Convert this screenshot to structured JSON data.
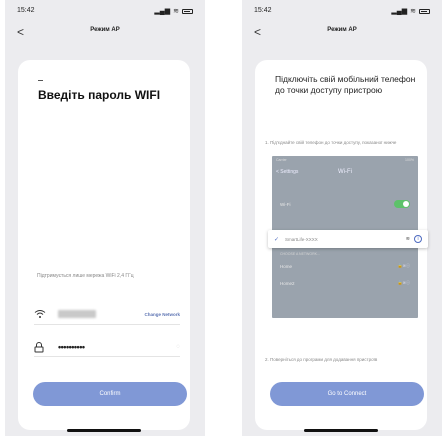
{
  "screens": [
    {
      "status": {
        "time": "15:42"
      },
      "nav": {
        "back": "<",
        "title": "Режим AP"
      },
      "card": {
        "title": "Введіть пароль WIFI",
        "note": "Підтримується лише мережа WiFi 2,4 ГГц",
        "change_network": "Change Network",
        "password": "••••••••••",
        "confirm": "Confirm"
      }
    },
    {
      "status": {
        "time": "15:42"
      },
      "nav": {
        "back": "<",
        "title": "Режим AP"
      },
      "card": {
        "title": "Підключіть свій мобільний телефон до точки доступу пристрою",
        "step1": "1. Під'єднайте свій телефон до точки доступу, показаної нижче",
        "preview": {
          "carrier": "Carrier",
          "battery": "100%",
          "back": "< Settings",
          "title": "Wi-Fi",
          "wifi_row": "Wi-Fi",
          "selected": "SmartLife-XXXX",
          "choose": "CHOOSE A NETWORK...",
          "net1": "Home",
          "net2": "Home2"
        },
        "step2": "2. Поверніться до програми для додавання пристроїв",
        "go_to_connect": "Go to Connect"
      }
    }
  ],
  "colors": {
    "accent": "#8098d6",
    "link": "#5d74b3",
    "check": "#4d6ac0"
  },
  "icons": [
    "wifi-icon",
    "lock-icon",
    "back-icon",
    "check-icon",
    "info-icon",
    "eye-icon"
  ]
}
